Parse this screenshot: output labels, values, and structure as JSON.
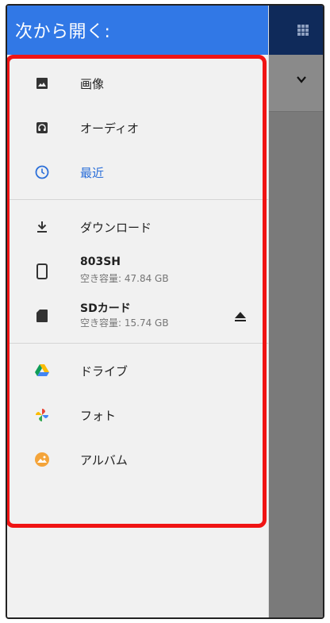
{
  "drawer": {
    "title": "次から開く:",
    "sections": [
      {
        "items": [
          {
            "label": "画像",
            "icon": "image-icon"
          },
          {
            "label": "オーディオ",
            "icon": "headphones-icon"
          },
          {
            "label": "最近",
            "icon": "clock-icon",
            "active": true
          }
        ]
      },
      {
        "items": [
          {
            "label": "ダウンロード",
            "icon": "download-icon"
          },
          {
            "label": "803SH",
            "sub": "空き容量: 47.84 GB",
            "icon": "phone-icon"
          },
          {
            "label": "SDカード",
            "sub": "空き容量: 15.74 GB",
            "icon": "sd-card-icon",
            "eject": true
          }
        ]
      },
      {
        "items": [
          {
            "label": "ドライブ",
            "icon": "drive-icon"
          },
          {
            "label": "フォト",
            "icon": "photos-icon"
          },
          {
            "label": "アルバム",
            "icon": "album-icon"
          }
        ]
      }
    ]
  },
  "colors": {
    "header": "#3178e6",
    "active": "#2b6fd9",
    "highlight": "#f01414",
    "app_bar": "#0f2a5a"
  }
}
